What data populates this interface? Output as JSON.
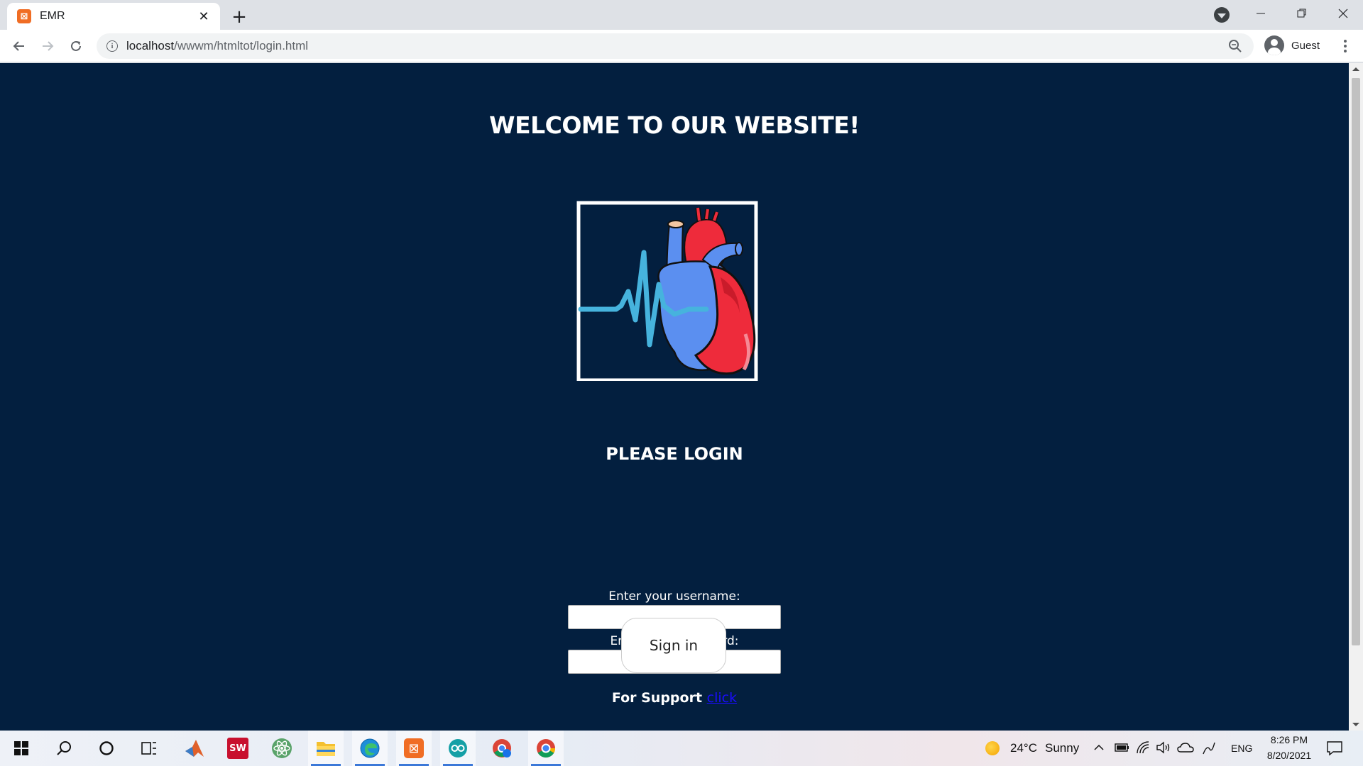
{
  "browser": {
    "tab": {
      "title": "EMR",
      "favicon": "xampp-icon"
    },
    "new_tab_label": "+",
    "url": {
      "host": "localhost",
      "path": "/wwwm/htmltot/login.html"
    },
    "profile": {
      "name": "Guest"
    }
  },
  "page": {
    "welcome_title": "WELCOME TO OUR WEBSITE!",
    "logo": "heart-with-ecg-logo",
    "login_heading": "PLEASE LOGIN",
    "username_label": "Enter your username:",
    "username_value": "",
    "password_label": "Enter your password:",
    "password_value": "",
    "signin_label": "Sign in",
    "support_text": "For Support",
    "support_link": "click",
    "background_color": "#031f3f"
  },
  "taskbar": {
    "apps": [
      "start-icon",
      "search-icon",
      "cortana-icon",
      "task-view-icon",
      "matlab-icon",
      "solidworks-icon",
      "atom-icon",
      "file-explorer-icon",
      "edge-icon",
      "xampp-icon",
      "arduino-icon",
      "chrome-app-icon",
      "chrome-icon"
    ],
    "solidworks_badge": "SW",
    "weather": {
      "temp": "24°C",
      "condition": "Sunny"
    },
    "language": "ENG",
    "time": "8:26 PM",
    "date": "8/20/2021"
  }
}
